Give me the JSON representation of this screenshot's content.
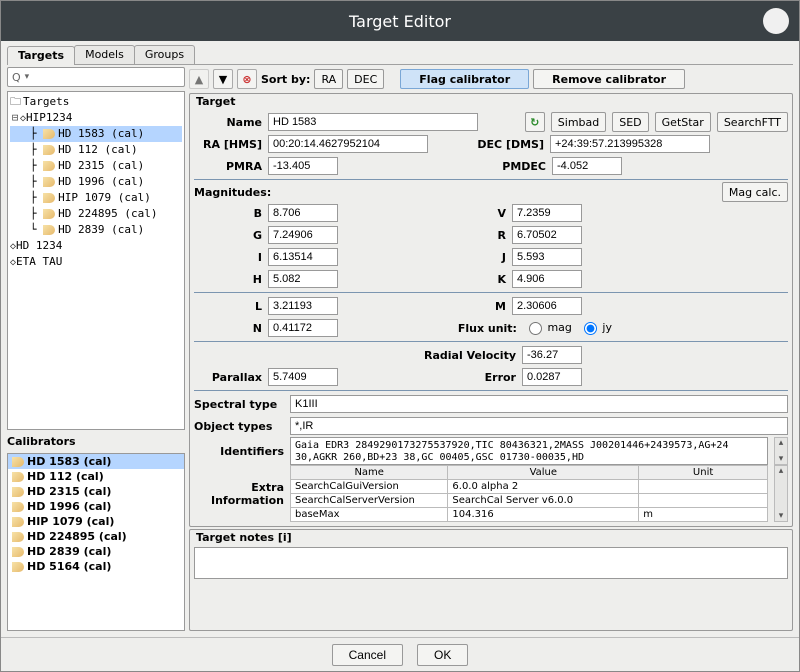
{
  "window": {
    "title": "Target Editor"
  },
  "tabs": {
    "targets": "Targets",
    "models": "Models",
    "groups": "Groups"
  },
  "search": {
    "placeholder": "Q"
  },
  "tree": {
    "root": "Targets",
    "hip": "HIP1234",
    "items": [
      "HD 1583 (cal)",
      "HD 112 (cal)",
      "HD 2315 (cal)",
      "HD 1996 (cal)",
      "HIP 1079 (cal)",
      "HD 224895 (cal)",
      "HD 2839 (cal)"
    ],
    "extra": [
      "HD 1234",
      "ETA TAU"
    ]
  },
  "calibrators": {
    "title": "Calibrators",
    "items": [
      "HD 1583 (cal)",
      "HD 112 (cal)",
      "HD 2315 (cal)",
      "HD 1996 (cal)",
      "HIP 1079 (cal)",
      "HD 224895 (cal)",
      "HD 2839 (cal)",
      "HD 5164 (cal)"
    ]
  },
  "toolbar": {
    "sortby": "Sort by:",
    "ra": "RA",
    "dec": "DEC",
    "flag": "Flag calibrator",
    "remove": "Remove calibrator"
  },
  "target": {
    "group": "Target",
    "name_label": "Name",
    "name": "HD 1583",
    "simbad": "Simbad",
    "sed": "SED",
    "getstar": "GetStar",
    "searchftt": "SearchFTT",
    "ra_label": "RA [HMS]",
    "ra": "00:20:14.4627952104",
    "dec_label": "DEC [DMS]",
    "dec": "+24:39:57.213995328",
    "pmra_label": "PMRA",
    "pmra": "-13.405",
    "pmdec_label": "PMDEC",
    "pmdec": "-4.052"
  },
  "mags": {
    "title": "Magnitudes:",
    "calc": "Mag calc.",
    "B": "8.706",
    "V": "7.2359",
    "G": "7.24906",
    "R": "6.70502",
    "I": "6.13514",
    "J": "5.593",
    "H": "5.082",
    "K": "4.906",
    "L": "3.21193",
    "M": "2.30606",
    "N": "0.41172",
    "fluxunit_label": "Flux unit:",
    "opt_mag": "mag",
    "opt_jy": "jy"
  },
  "misc": {
    "rv_label": "Radial Velocity",
    "rv": "-36.27",
    "par_label": "Parallax",
    "par": "5.7409",
    "err_label": "Error",
    "err": "0.0287",
    "sptype_label": "Spectral type",
    "sptype": "K1III",
    "objtypes_label": "Object types",
    "objtypes": "*,IR",
    "ident_label": "Identifiers",
    "ident": "Gaia EDR3 2849290173275537920,TIC 80436321,2MASS J00201446+2439573,AG+24 30,AGKR 260,BD+23 38,GC 00405,GSC 01730-00035,HD"
  },
  "extra": {
    "label": "Extra Information",
    "cols": {
      "name": "Name",
      "value": "Value",
      "unit": "Unit"
    },
    "rows": [
      {
        "name": "SearchCalGuiVersion",
        "value": "6.0.0 alpha 2",
        "unit": ""
      },
      {
        "name": "SearchCalServerVersion",
        "value": "SearchCal Server v6.0.0",
        "unit": ""
      },
      {
        "name": "baseMax",
        "value": "104.316",
        "unit": "m"
      }
    ]
  },
  "notes": {
    "title": "Target notes [i]"
  },
  "footer": {
    "cancel": "Cancel",
    "ok": "OK"
  }
}
